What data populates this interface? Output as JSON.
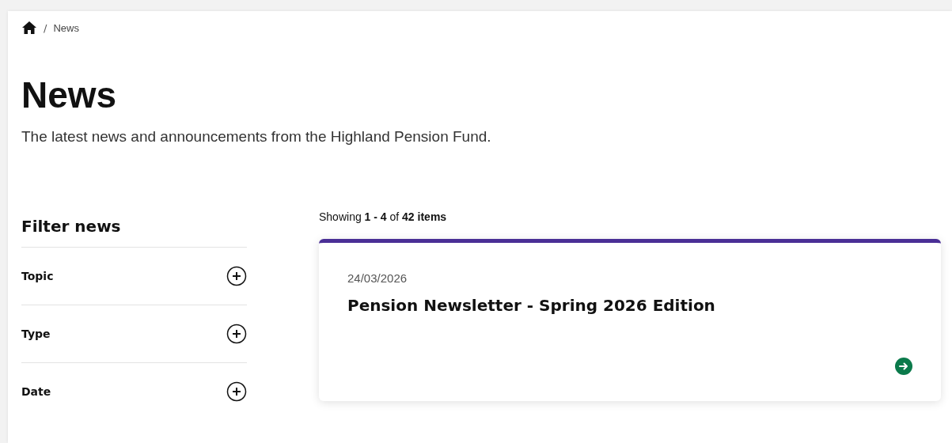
{
  "breadcrumb": {
    "items": [
      {
        "separator": "/",
        "label": "News"
      }
    ]
  },
  "page": {
    "title": "News",
    "intro": "The latest news and announcements from the Highland Pension Fund."
  },
  "filters": {
    "heading": "Filter news",
    "groups": [
      {
        "label": "Topic",
        "expanded": false
      },
      {
        "label": "Type",
        "expanded": false
      },
      {
        "label": "Date",
        "expanded": false
      }
    ]
  },
  "results": {
    "summary": "Showing **1 - 4** of **42 items**",
    "items": [
      {
        "date": "24/03/2026",
        "title": "Pension Newsletter - Spring 2026 Edition"
      }
    ]
  }
}
